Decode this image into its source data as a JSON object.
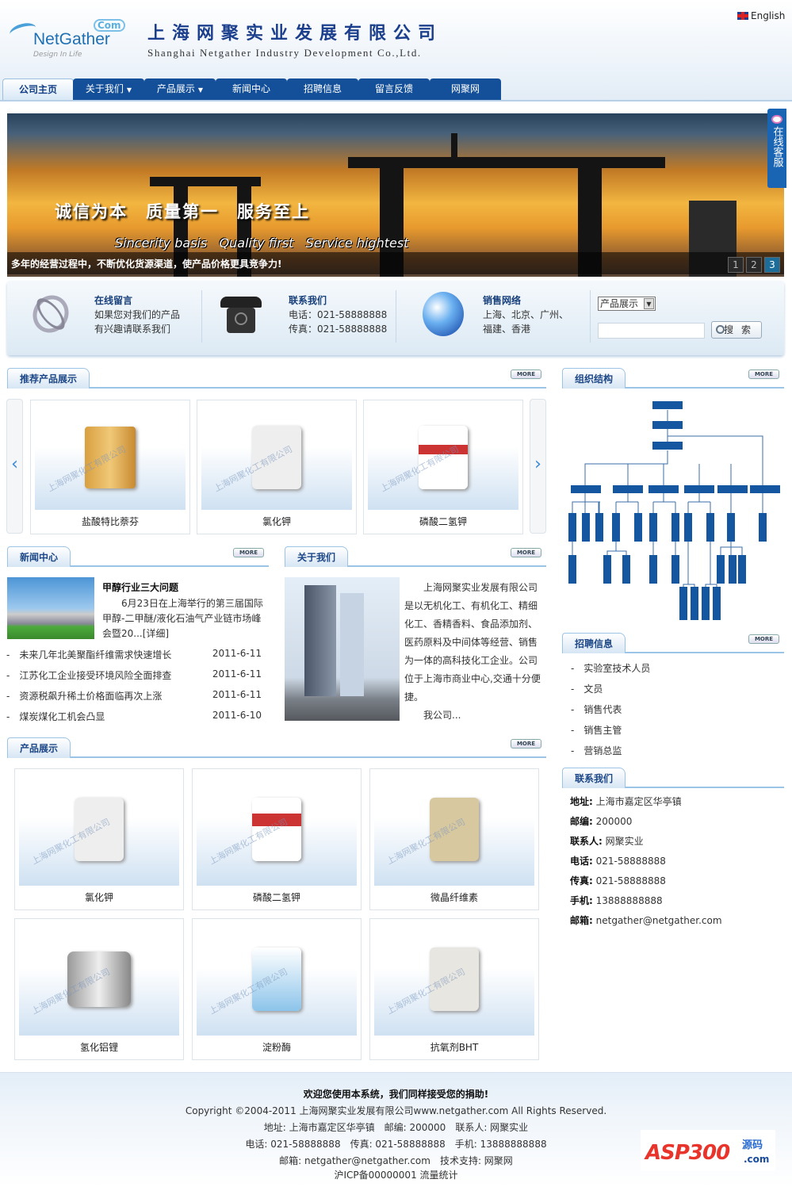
{
  "header": {
    "logo_text": "NetGather",
    "logo_com": "Com",
    "logo_tagline": "Design In Life",
    "title_cn": "上海网聚实业发展有限公司",
    "title_en": "Shanghai Netgather Industry Development Co.,Ltd.",
    "language_link": "English"
  },
  "nav": {
    "items": [
      {
        "label": "公司主页",
        "active": true
      },
      {
        "label": "关于我们",
        "dropdown": true
      },
      {
        "label": "产品展示",
        "dropdown": true
      },
      {
        "label": "新闻中心"
      },
      {
        "label": "招聘信息"
      },
      {
        "label": "留言反馈"
      },
      {
        "label": "网聚网"
      }
    ],
    "arrow": "▼"
  },
  "banner": {
    "slogan_cn": "诚信为本　质量第一　服务至上",
    "slogan_en": "Sincerity basis   Quality first   Service hightest",
    "caption": "多年的经营过程中，不断优化货源渠道，使产品价格更具竞争力!",
    "pages": [
      "1",
      "2",
      "3"
    ],
    "active_page": 3
  },
  "online_service": {
    "label": "在线客服"
  },
  "infobar": {
    "message": {
      "title": "在线留言",
      "lines": [
        "如果您对我们的产品",
        "有兴趣请联系我们"
      ]
    },
    "contact": {
      "title": "联系我们",
      "lines": [
        "电话：021-58888888",
        "传真：021-58888888"
      ]
    },
    "network": {
      "title": "销售网络",
      "lines": [
        "上海、北京、广州、",
        "福建、香港"
      ]
    },
    "search": {
      "select_value": "产品展示",
      "input_value": "",
      "button": "搜 索"
    }
  },
  "more_label": "MORE",
  "recommended": {
    "title": "推荐产品展示",
    "items": [
      {
        "name": "盐酸特比萘芬"
      },
      {
        "name": "氯化钾"
      },
      {
        "name": "磷酸二氢钾"
      }
    ],
    "prev": "‹",
    "next": "›",
    "watermark": "上海网聚化工有限公司"
  },
  "news": {
    "title": "新闻中心",
    "featured": {
      "title": "甲醇行业三大问题",
      "summary": "6月23日在上海举行的第三届国际甲醇-二甲醚/液化石油气产业链市场峰会暨20...",
      "more": "[详细]"
    },
    "items": [
      {
        "title": "未来几年北美聚酯纤维需求快速增长",
        "date": "2011-6-11"
      },
      {
        "title": "江苏化工企业接受环境风险全面排查",
        "date": "2011-6-11"
      },
      {
        "title": "资源税飙升稀土价格面临再次上涨",
        "date": "2011-6-11"
      },
      {
        "title": "煤炭煤化工机会凸显",
        "date": "2011-6-10"
      }
    ]
  },
  "about": {
    "title": "关于我们",
    "text": "上海网聚实业发展有限公司是以无机化工、有机化工、精细化工、香精香料、食品添加剂、医药原料及中间体等经营、销售为一体的高科技化工企业。公司位于上海市商业中心,交通十分便捷。",
    "more": "我公司..."
  },
  "products": {
    "title": "产品展示",
    "items": [
      {
        "name": "氯化钾"
      },
      {
        "name": "磷酸二氢钾"
      },
      {
        "name": "微晶纤维素"
      },
      {
        "name": "氢化铝锂"
      },
      {
        "name": "淀粉酶"
      },
      {
        "name": "抗氧剂BHT"
      }
    ]
  },
  "org": {
    "title": "组织结构"
  },
  "jobs": {
    "title": "招聘信息",
    "items": [
      "实验室技术人员",
      "文员",
      "销售代表",
      "销售主管",
      "营销总监"
    ]
  },
  "contact": {
    "title": "联系我们",
    "items": [
      {
        "k": "地址:",
        "v": " 上海市嘉定区华亭镇"
      },
      {
        "k": "邮编:",
        "v": " 200000"
      },
      {
        "k": "联系人:",
        "v": " 网聚实业"
      },
      {
        "k": "电话:",
        "v": " 021-58888888"
      },
      {
        "k": "传真:",
        "v": " 021-58888888"
      },
      {
        "k": "手机:",
        "v": " 13888888888"
      },
      {
        "k": "邮箱:",
        "v": " netgather@netgather.com"
      }
    ]
  },
  "footer": {
    "lines": [
      "欢迎您使用本系统，我们同样接受您的捐助!",
      "Copyright ©2004-2011 上海网聚实业发展有限公司www.netgather.com All Rights Reserved.",
      "地址: 上海市嘉定区华亭镇　邮编: 200000　联系人: 网聚实业",
      "电话: 021-58888888　传真: 021-58888888　手机: 13888888888",
      "邮箱: netgather@netgather.com　技术支持: 网聚网",
      "沪ICP备00000001 流量统计"
    ],
    "badge": "ASP300源码 .com"
  },
  "colors": {
    "brand": "#14509a",
    "title": "#1d4786",
    "link": "#173f7a"
  }
}
